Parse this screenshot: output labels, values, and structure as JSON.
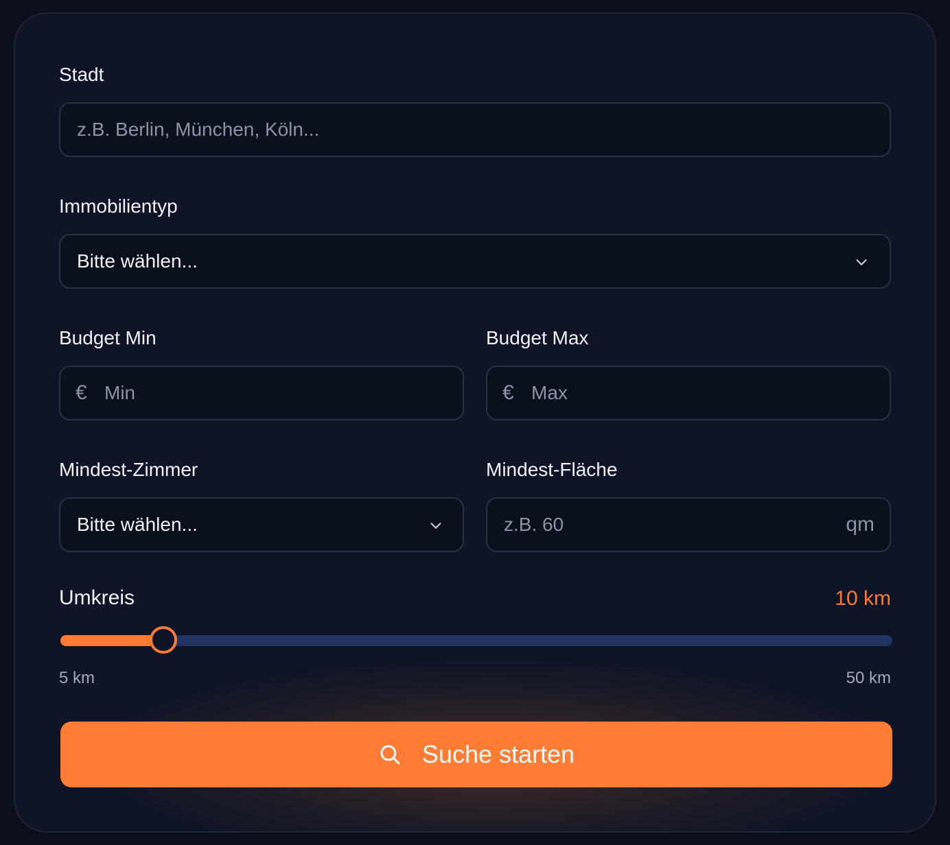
{
  "form": {
    "city": {
      "label": "Stadt",
      "placeholder": "z.B. Berlin, München, Köln..."
    },
    "property_type": {
      "label": "Immobilientyp",
      "selected": "Bitte wählen..."
    },
    "budget_min": {
      "label": "Budget Min",
      "currency_symbol": "€",
      "placeholder": "Min"
    },
    "budget_max": {
      "label": "Budget Max",
      "currency_symbol": "€",
      "placeholder": "Max"
    },
    "min_rooms": {
      "label": "Mindest-Zimmer",
      "selected": "Bitte wählen..."
    },
    "min_area": {
      "label": "Mindest-Fläche",
      "placeholder": "z.B. 60",
      "unit": "qm"
    },
    "radius": {
      "label": "Umkreis",
      "value_text": "10 km",
      "value": 10,
      "min": 5,
      "max": 50,
      "min_label": "5 km",
      "max_label": "50 km"
    },
    "submit": {
      "label": "Suche starten",
      "icon": "search-icon"
    }
  },
  "colors": {
    "accent": "#ff7a35",
    "track": "#1f355f",
    "background": "#0f1526",
    "input_background": "#0b101d"
  }
}
